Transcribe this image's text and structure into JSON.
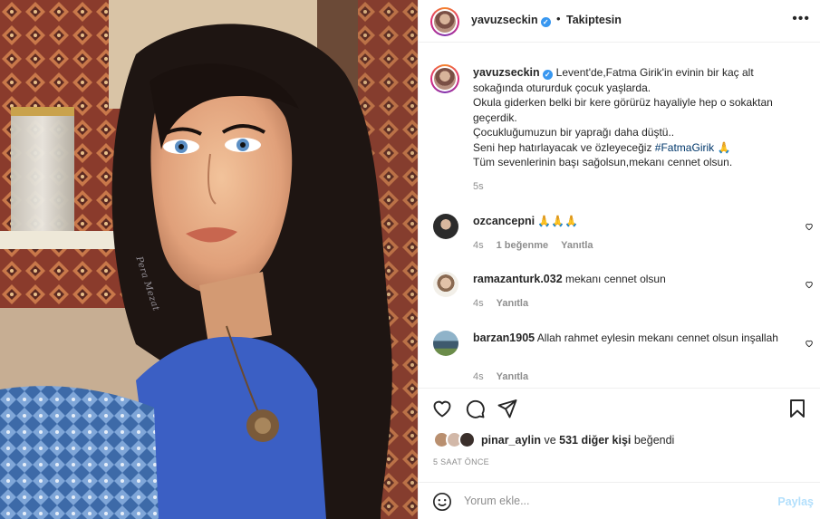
{
  "post": {
    "image_alt": "Portrait photo",
    "watermark": "Pera Mezat"
  },
  "header": {
    "username": "yavuzseckin",
    "verified_icon": "verified-badge-icon",
    "separator": "•",
    "follow_status": "Takiptesin",
    "more_icon": "more-options-icon"
  },
  "caption": {
    "username": "yavuzseckin",
    "text_before_hashtag": "Levent'de,Fatma Girik'in evinin bir kaç alt sokağında otururduk çocuk yaşlarda.\nOkula giderken belki bir kere görürüz hayaliyle hep o sokaktan geçerdik.\nÇocukluğumuzun bir yaprağı daha düştü..\nSeni hep hatırlayacak ve özleyeceğiz ",
    "hashtag": "#FatmaGirik",
    "emoji": " 🙏",
    "text_after": "Tüm sevenlerinin başı sağolsun,mekanı cennet olsun.",
    "time": "5s"
  },
  "comments": [
    {
      "username": "ozcancepni",
      "text": "🙏🙏🙏",
      "time": "4s",
      "likes": "1 beğenme",
      "reply": "Yanıtla",
      "avatar_color": "#2b2b2b"
    },
    {
      "username": "ramazanturk.032",
      "text": "mekanı cennet olsun",
      "time": "4s",
      "likes": "",
      "reply": "Yanıtla",
      "avatar_color": "#c9a58a"
    },
    {
      "username": "barzan1905",
      "text": "Allah rahmet eylesin mekanı cennet olsun inşallah",
      "time": "4s",
      "likes": "",
      "reply": "Yanıtla",
      "avatar_color": "#4a6f8a"
    }
  ],
  "actions": {
    "like_icon": "heart-icon",
    "comment_icon": "comment-icon",
    "share_icon": "share-icon",
    "save_icon": "bookmark-icon"
  },
  "likes": {
    "first_liker": "pinar_aylin",
    "connector": " ve ",
    "others": "531 diğer kişi",
    "suffix": " beğendi",
    "face_colors": [
      "#b98f6f",
      "#d2b8a8",
      "#3a2f2b"
    ]
  },
  "time_ago": "5 SAAT ÖNCE",
  "add_comment": {
    "placeholder": "Yorum ekle...",
    "post_label": "Paylaş",
    "emoji_icon": "emoji-icon"
  },
  "colors": {
    "link": "#00376b",
    "post_disabled": "#b2dffc",
    "verified": "#3897f0",
    "muted": "#8e8e8e"
  }
}
